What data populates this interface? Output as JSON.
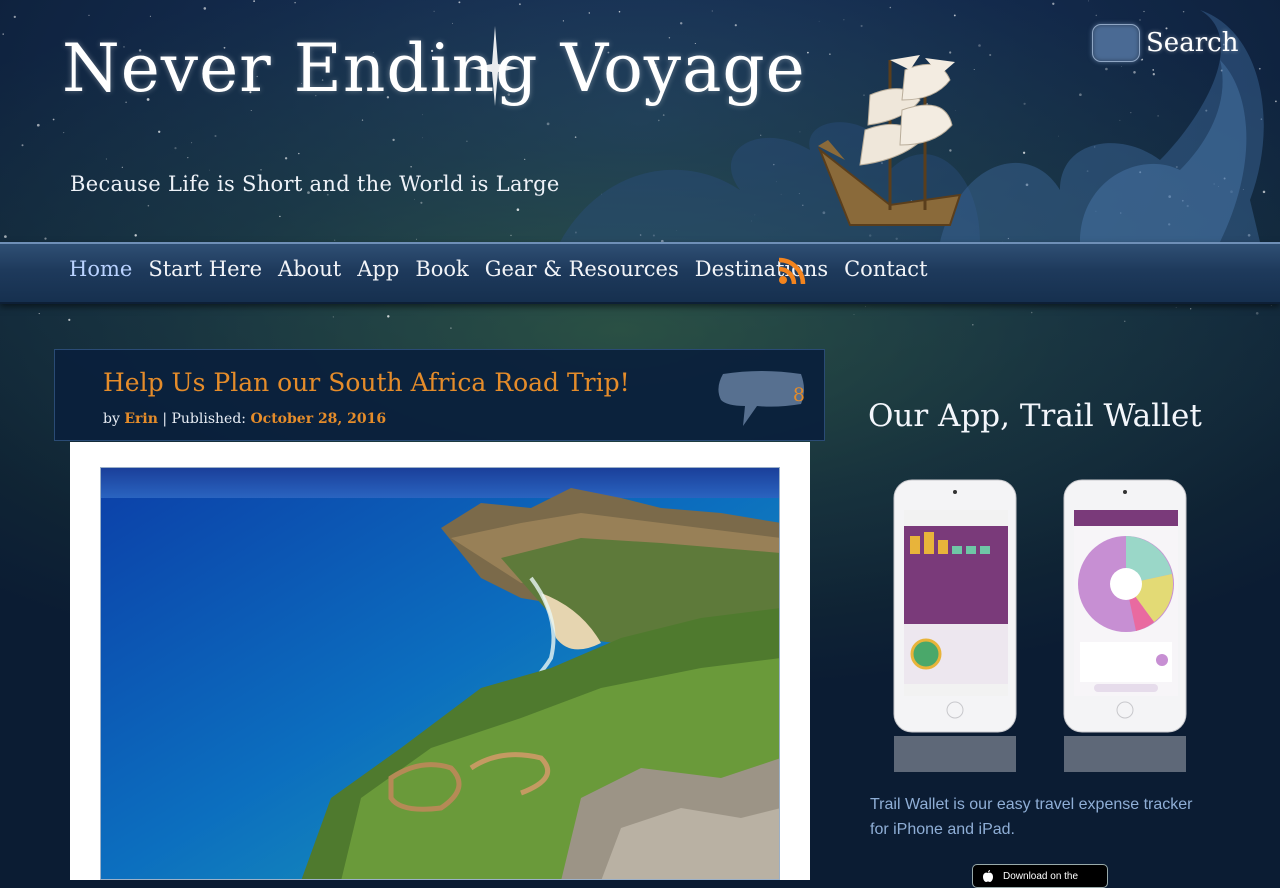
{
  "site": {
    "title": "Never Ending Voyage",
    "tagline": "Because Life is Short and the World is Large"
  },
  "search": {
    "label": "Search",
    "placeholder": ""
  },
  "nav": {
    "items": [
      {
        "label": "Home",
        "active": true
      },
      {
        "label": "Start Here"
      },
      {
        "label": "About"
      },
      {
        "label": "App"
      },
      {
        "label": "Book"
      },
      {
        "label": "Gear & Resources"
      },
      {
        "label": "Destinations"
      },
      {
        "label": "Contact"
      }
    ],
    "rss_icon": "rss-icon"
  },
  "post": {
    "title": "Help Us Plan our South Africa Road Trip!",
    "by_label": "by",
    "author": "Erin",
    "published_label": " | Published: ",
    "date": "October 28, 2016",
    "comment_count": "8",
    "image_alt": "Cape Point coastline, South Africa"
  },
  "sidebar": {
    "widget_title": "Our App, Trail Wallet",
    "description": "Trail Wallet is our easy travel expense tracker for iPhone and iPad.",
    "badge_text": "Download on the"
  },
  "colors": {
    "accent": "#e58c2a",
    "nav_bg": "#1e3a5c",
    "link_blue": "#8faed6"
  }
}
